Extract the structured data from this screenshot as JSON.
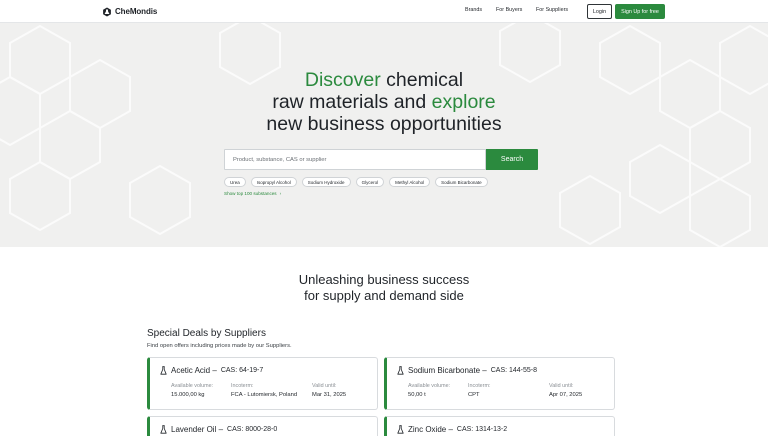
{
  "header": {
    "logo_text": "CheMondis",
    "nav": [
      "Brands",
      "For Buyers",
      "For Suppliers"
    ],
    "login_label": "Login",
    "signup_label": "Sign Up for free"
  },
  "hero": {
    "title_line1_green": "Discover",
    "title_line1_rest": " chemical",
    "title_line2_start": "raw materials and ",
    "title_line2_green": "explore",
    "title_line3": "new business opportunities",
    "search_placeholder": "Product, substance, CAS or supplier",
    "search_button": "Search",
    "chips": [
      "Urea",
      "Isopropyl Alcohol",
      "Sodium Hydroxide",
      "Glycerol",
      "Methyl Alcohol",
      "Sodium Bicarbonate"
    ],
    "show_top_label": "Show top 100 substances",
    "show_top_arrow": "›"
  },
  "section": {
    "title_line1": "Unleashing business success",
    "title_line2": "for supply and demand side"
  },
  "deals": {
    "heading": "Special Deals by Suppliers",
    "subheading": "Find open offers including prices made by our Suppliers.",
    "labels": {
      "volume": "Available volume:",
      "incoterm": "Incoterm:",
      "valid": "Valid until:"
    },
    "cards": [
      {
        "name": "Acetic Acid –",
        "cas": "CAS: 64-19-7",
        "volume": "15.000,00 kg",
        "incoterm": "FCA - Lutomiersk, Poland",
        "valid": "Mar 31, 2025"
      },
      {
        "name": "Sodium Bicarbonate –",
        "cas": "CAS: 144-55-8",
        "volume": "50,00 t",
        "incoterm": "CPT",
        "valid": "Apr 07, 2025"
      },
      {
        "name": "Lavender Oil –",
        "cas": "CAS: 8000-28-0"
      },
      {
        "name": "Zinc Oxide –",
        "cas": "CAS: 1314-13-2"
      }
    ]
  },
  "colors": {
    "brand_green": "#2b8a3e",
    "hero_bg": "#f0f0ef",
    "text": "#1f2328"
  },
  "icons": [
    "logo-flask-icon",
    "flask-icon",
    "chevron-right-icon"
  ]
}
